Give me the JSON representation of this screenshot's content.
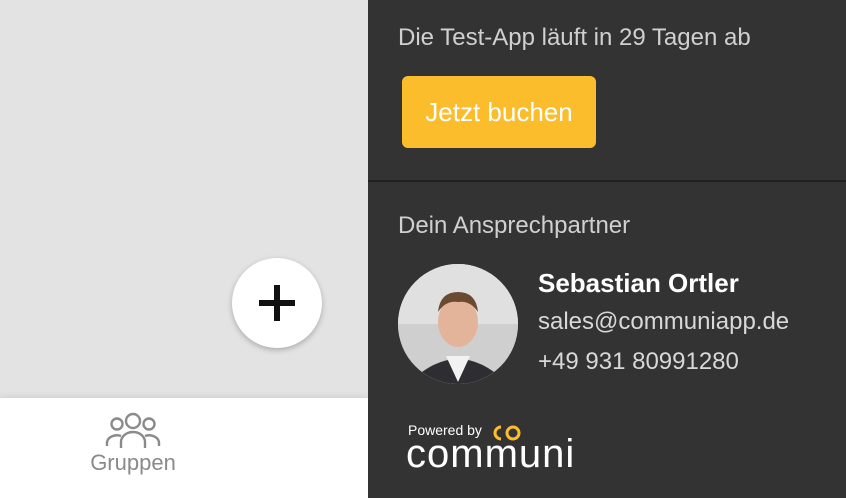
{
  "left": {
    "fab_icon": "plus-icon",
    "nav": {
      "items": [
        {
          "label": "Gruppen",
          "icon": "users-group-icon"
        }
      ]
    }
  },
  "right": {
    "trial_text": "Die Test-App läuft in 29 Tagen ab",
    "book_button": "Jetzt buchen",
    "contact_heading": "Dein Ansprechpartner",
    "contact": {
      "name": "Sebastian Ortler",
      "email": "sales@communiapp.de",
      "phone": "+49 931 80991280"
    },
    "powered_by": "Powered by",
    "brand": "communi"
  },
  "colors": {
    "accent": "#fbbd2c",
    "panel_bg": "#333333",
    "left_bg": "#e3e3e3"
  }
}
